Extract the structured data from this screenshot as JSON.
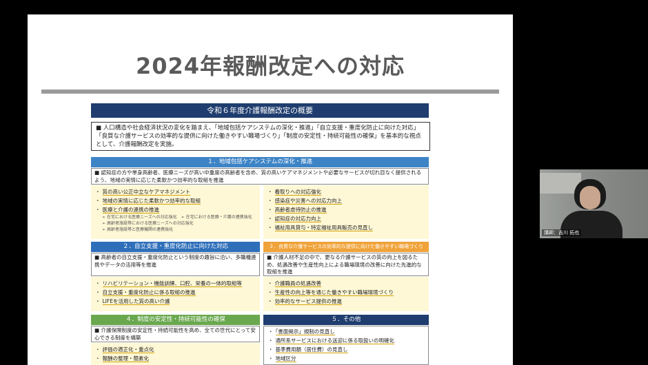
{
  "slide": {
    "title": "2024年報酬改定への対応",
    "doc_header": "令和６年度介護報酬改定の概要",
    "intro": "■ 人口構造や社会経済状況の変化を踏まえ、「地域包括ケアシステムの深化・推進」「自立支援・重度化防止に向けた対応」「良質な介護サービスの効率的な提供に向けた働きやすい職場づくり」「制度の安定性・持続可能性の確保」を基本的な視点として、介護報酬改定を実施。",
    "sections": {
      "s1": {
        "heading": "１．地域包括ケアシステムの深化・推進",
        "desc": "■ 認知症の方や単身高齢者、医療ニーズが高い中重度の高齢者を含め、質の高いケアマネジメントや必要なサービスが切れ目なく提供されるよう、地域の実情に応じた柔軟かつ効率的な取組を推進",
        "left_items": {
          "i0": "質の高い公正中立なケアマネジメント",
          "i1": "地域の実情に応じた柔軟かつ効率的な取組",
          "i2": "医療と介護の連携の推進",
          "i2a": "在宅における医療ニーズへの対応強化",
          "i2b": "在宅における医療・介護の連携強化",
          "i2c": "高齢者施設等における医療ニーズへの対応強化",
          "i2d": "高齢者施設等と医療機関の連携強化"
        },
        "right_items": {
          "i0": "看取りへの対応強化",
          "i1": "感染症や災害への対応力向上",
          "i2": "高齢者虐待防止の推進",
          "i3": "認知症の対応力向上",
          "i4": "福祉用具貸与・特定福祉用具販売の見直し"
        }
      },
      "s2": {
        "heading": "２．自立支援・重度化防止に向けた対応",
        "desc": "■ 高齢者の自立支援・重度化防止という制度の趣旨に沿い、多職種連携やデータの活用等を推進",
        "items": {
          "i0": "リハビリテーション・機能訓練、口腔、栄養の一体的取組等",
          "i1": "自立支援・重度化防止に係る取組の推進",
          "i2": "LIFEを活用した質の高い介護"
        }
      },
      "s3": {
        "heading": "３．良質な介護サービスの効率的な提供に向けた働きやすい職場づくり",
        "desc": "■ 介護人材不足の中で、更なる介護サービスの質の向上を図るため、処遇改善や生産性向上による職場環境の改善に向けた先進的な取組を推進",
        "items": {
          "i0": "介護職員の処遇改善",
          "i1": "生産性の向上等を通じた働きやすい職場環境づくり",
          "i2": "効率的なサービス提供の推進"
        }
      },
      "s4": {
        "heading": "４．制度の安定性・持続可能性の確保",
        "desc": "■ 介護保険制度の安定性・持続可能性を高め、全ての世代にとって安心できる制度を構築",
        "items": {
          "i0": "評価の適正化・重点化",
          "i1": "報酬の整理・簡素化"
        }
      },
      "s5": {
        "heading": "５．その他",
        "items": {
          "i0": "「書面掲示」規制の見直し",
          "i1": "通所系サービスにおける送迎に係る取扱いの明確化",
          "i2": "基準費用額（居住費）の見直し",
          "i3": "地域区分"
        }
      }
    }
  },
  "webcam": {
    "label": "講師：吉川 拓也"
  },
  "colors": {
    "header_navy": "#1f3d6e",
    "sec1_blue": "#3d84c6",
    "sec2_blue": "#2f6fba",
    "sec3_orange": "#f0a33a",
    "sec4_green": "#6aa84f",
    "sec5_navy": "#1f3d6e",
    "list_bg": "#fff8d6"
  }
}
